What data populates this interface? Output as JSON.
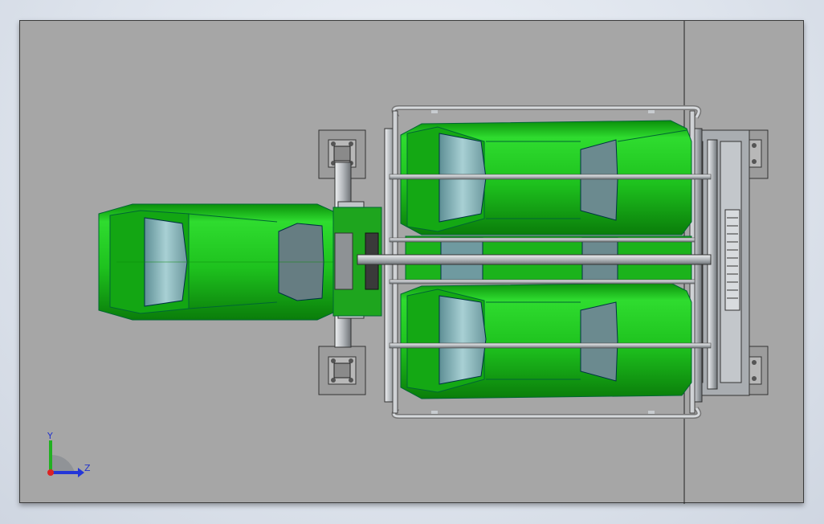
{
  "triad": {
    "y_label": "Y",
    "z_label": "Z"
  },
  "colors": {
    "background": "#a6a6a6",
    "body_green": "#1fc21f",
    "frame_steel": "#c8ccd0",
    "window_glass": "#7fb2b8"
  }
}
